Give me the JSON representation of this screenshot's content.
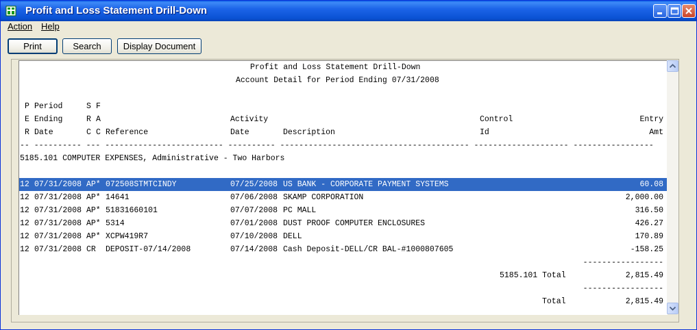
{
  "window": {
    "title": "Profit and Loss Statement Drill-Down",
    "colors": {
      "titlebar": "#0a52d4",
      "highlight": "#316ac5"
    }
  },
  "menu": {
    "action": "Action",
    "help": "Help"
  },
  "toolbar": {
    "print": "Print",
    "search": "Search",
    "display_document": "Display Document"
  },
  "report": {
    "title": "Profit and Loss Statement Drill-Down",
    "subtitle": "Account Detail for Period Ending 07/31/2008",
    "headers": {
      "row1": {
        "per": "P",
        "period": "Period",
        "src": "S",
        "fa": "F"
      },
      "row2": {
        "per": "E",
        "period": "Ending",
        "src": "R",
        "fa": "A",
        "activity": "Activity",
        "control": "Control",
        "entry": "Entry"
      },
      "row3": {
        "per": "R",
        "period": "Date",
        "src": "C",
        "fa": "C",
        "reference": "Reference",
        "activity": "Date",
        "description": "Description",
        "control": "Id",
        "entry": "Amt"
      }
    },
    "separator": "-- ---------- --- ------------------------- ---------- ---------------------------------------- -------------------- -----------------",
    "account": "5185.101 COMPUTER EXPENSES, Administrative - Two Harbors",
    "rows": [
      {
        "per": "12",
        "period": "07/31/2008",
        "srcfa": "AP*",
        "reference": "072508STMTCINDY",
        "activity": "07/25/2008",
        "description": "US BANK - CORPORATE PAYMENT SYSTEMS",
        "amount": "60.08"
      },
      {
        "per": "12",
        "period": "07/31/2008",
        "srcfa": "AP*",
        "reference": "14641",
        "activity": "07/06/2008",
        "description": "SKAMP CORPORATION",
        "amount": "2,000.00"
      },
      {
        "per": "12",
        "period": "07/31/2008",
        "srcfa": "AP*",
        "reference": "51831660101",
        "activity": "07/07/2008",
        "description": "PC MALL",
        "amount": "316.50"
      },
      {
        "per": "12",
        "period": "07/31/2008",
        "srcfa": "AP*",
        "reference": "5314",
        "activity": "07/01/2008",
        "description": "DUST PROOF COMPUTER ENCLOSURES",
        "amount": "426.27"
      },
      {
        "per": "12",
        "period": "07/31/2008",
        "srcfa": "AP*",
        "reference": "XCPW419R7",
        "activity": "07/10/2008",
        "description": "DELL",
        "amount": "170.89"
      },
      {
        "per": "12",
        "period": "07/31/2008",
        "srcfa": "CR",
        "reference": "DEPOSIT-07/14/2008",
        "activity": "07/14/2008",
        "description": "Cash Deposit-DELL/CR BAL-#1000807605",
        "amount": "-158.25"
      }
    ],
    "total_line": "-----------------",
    "account_total": {
      "label": "5185.101 Total",
      "amount": "2,815.49"
    },
    "grand_total": {
      "label": "Total",
      "amount": "2,815.49"
    }
  }
}
